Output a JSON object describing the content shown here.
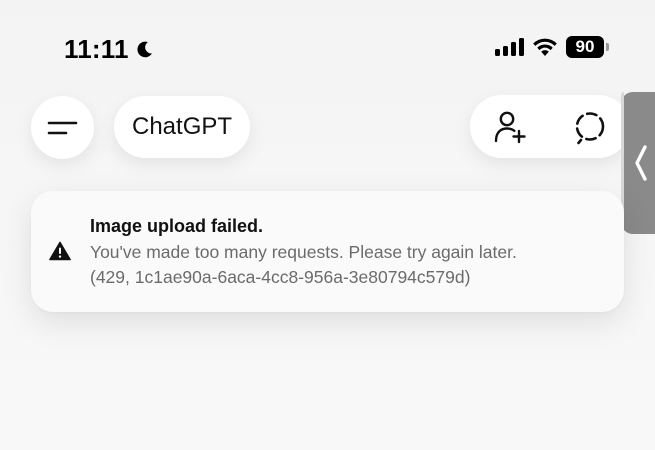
{
  "status_bar": {
    "time": "11:11",
    "battery": "90",
    "moon_icon": "moon-icon",
    "signal_icon": "cellular-signal-icon",
    "wifi_icon": "wifi-icon"
  },
  "header": {
    "menu_icon": "menu-icon",
    "title": "ChatGPT",
    "add_people_icon": "add-person-icon",
    "temporary_chat_icon": "dashed-circle-icon"
  },
  "toast": {
    "icon": "warning-icon",
    "title": "Image upload failed.",
    "message_line1": "You've made too many requests. Please try again later.",
    "message_line2": "(429, 1c1ae90a-6aca-4cc8-956a-3e80794c579d)"
  },
  "side_handle": {
    "icon": "chevron-left-icon"
  },
  "colors": {
    "background": "#f5f5f5",
    "toast_bg": "#fafafa",
    "body_text": "#6b6b6b",
    "handle": "#8a8a8a"
  }
}
